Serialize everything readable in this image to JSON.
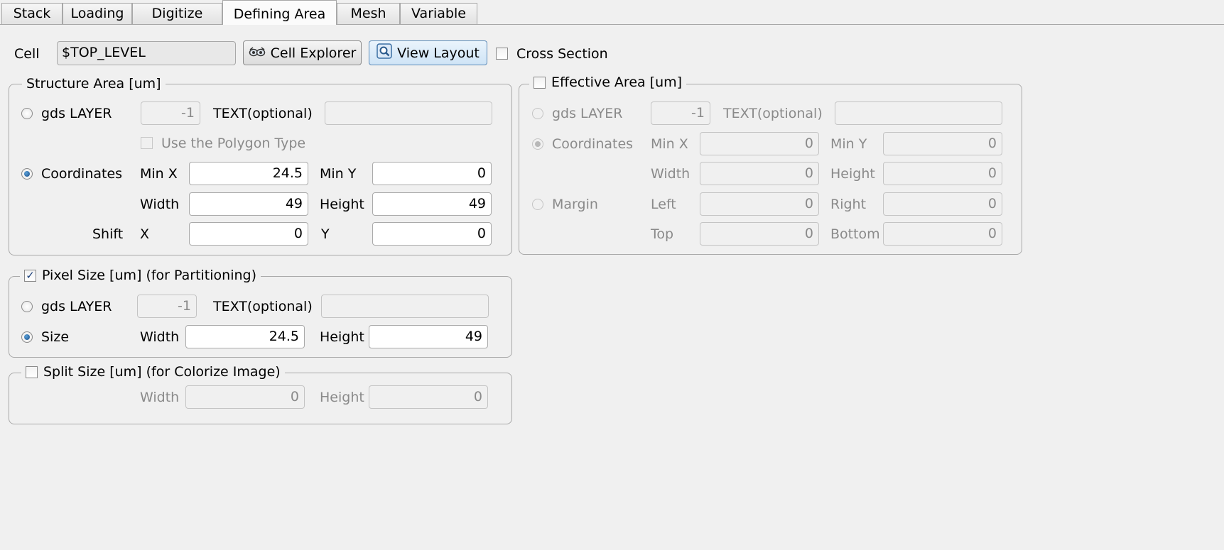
{
  "tabs": [
    "Stack",
    "Loading",
    "Digitize",
    "Defining Area",
    "Mesh",
    "Variable"
  ],
  "active_tab": "Defining Area",
  "cell": {
    "label": "Cell",
    "value": "$TOP_LEVEL",
    "cell_explorer_label": "Cell Explorer",
    "view_layout_label": "View Layout",
    "cross_section_label": "Cross Section",
    "cross_section_checked": false
  },
  "structure_area": {
    "title": "Structure Area [um]",
    "gds_layer_label": "gds LAYER",
    "gds_layer_value": "-1",
    "text_optional_label": "TEXT(optional)",
    "text_optional_value": "",
    "use_polygon_label": "Use the Polygon Type",
    "coordinates_label": "Coordinates",
    "selected_mode": "Coordinates",
    "min_x_label": "Min X",
    "min_x": "24.5",
    "min_y_label": "Min Y",
    "min_y": "0",
    "width_label": "Width",
    "width": "49",
    "height_label": "Height",
    "height": "49",
    "shift_label": "Shift",
    "shift_x_label": "X",
    "shift_x": "0",
    "shift_y_label": "Y",
    "shift_y": "0"
  },
  "effective_area": {
    "title": "Effective Area [um]",
    "enabled": false,
    "gds_layer_label": "gds LAYER",
    "gds_layer_value": "-1",
    "text_optional_label": "TEXT(optional)",
    "text_optional_value": "",
    "coordinates_label": "Coordinates",
    "min_x_label": "Min X",
    "min_x": "0",
    "min_y_label": "Min Y",
    "min_y": "0",
    "width_label": "Width",
    "width": "0",
    "height_label": "Height",
    "height": "0",
    "margin_label": "Margin",
    "left_label": "Left",
    "left": "0",
    "right_label": "Right",
    "right": "0",
    "top_label": "Top",
    "top": "0",
    "bottom_label": "Bottom",
    "bottom": "0"
  },
  "pixel_size": {
    "title": "Pixel Size [um] (for Partitioning)",
    "enabled": true,
    "gds_layer_label": "gds LAYER",
    "gds_layer_value": "-1",
    "text_optional_label": "TEXT(optional)",
    "text_optional_value": "",
    "size_label": "Size",
    "selected_mode": "Size",
    "width_label": "Width",
    "width": "24.5",
    "height_label": "Height",
    "height": "49"
  },
  "split_size": {
    "title": "Split Size [um] (for Colorize Image)",
    "enabled": false,
    "width_label": "Width",
    "width": "0",
    "height_label": "Height",
    "height": "0"
  },
  "colors": {
    "background": "#f0f0f0",
    "disabled_text": "#8a8a8a",
    "radio_selected": "#1a4f8a"
  }
}
